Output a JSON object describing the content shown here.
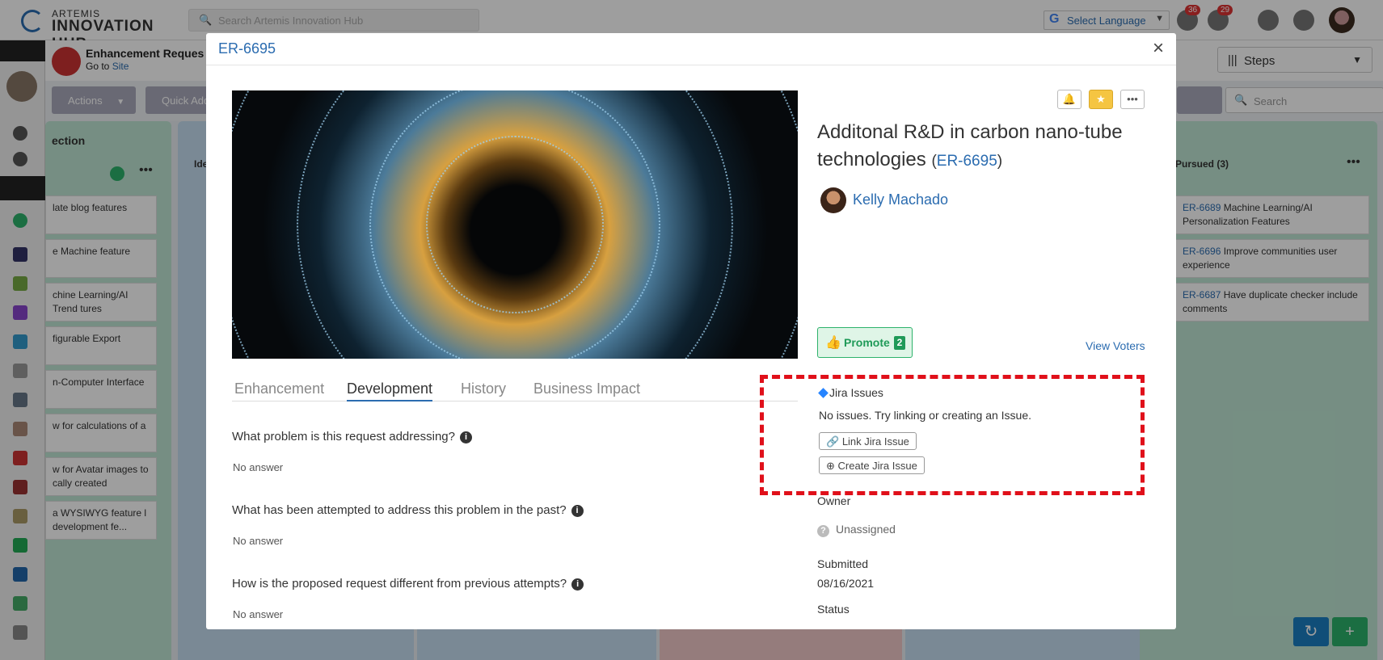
{
  "app": {
    "logo_top": "ARTEMIS",
    "logo_bottom": "INNOVATION HUB",
    "search_placeholder": "Search Artemis Innovation Hub",
    "language": "Select Language",
    "notifications_count": "36",
    "clock_count": "29"
  },
  "page": {
    "title": "Enhancement Reques",
    "subtitle_prefix": "Go to",
    "subtitle_link": "Site",
    "steps_label": "Steps",
    "actions_label": "Actions",
    "quick_add_label": "Quick Add",
    "search_placeholder": "Search"
  },
  "board": {
    "col1_title": "ection",
    "col2_title": "Ide",
    "col5_title": "Pursued (3)",
    "col1_cards": [
      "late blog features",
      "e Machine feature",
      "chine Learning/AI Trend tures",
      "figurable Export",
      "n-Computer Interface",
      "w for calculations of a",
      "w for Avatar images to cally created",
      "a WYSIWYG feature l development fe..."
    ],
    "pursued_cards": [
      {
        "id": "ER-6689",
        "text": "Machine Learning/AI Personalization Features"
      },
      {
        "id": "ER-6696",
        "text": "Improve communities user experience"
      },
      {
        "id": "ER-6687",
        "text": "Have duplicate checker include comments"
      }
    ]
  },
  "modal": {
    "id": "ER-6695",
    "close_glyph": "×",
    "title": "Additonal R&D in carbon nano-tube technologies",
    "title_paren_open": "(",
    "title_id": "ER-6695",
    "title_paren_close": ")",
    "author": "Kelly Machado",
    "promote_label": "Promote",
    "promote_count": "2",
    "view_voters": "View Voters",
    "tabs": [
      "Enhancement",
      "Development",
      "History",
      "Business Impact"
    ],
    "active_tab": "Development",
    "questions": [
      {
        "q": "What problem is this request addressing?",
        "a": "No answer"
      },
      {
        "q": "What has been attempted to address this problem in the past?",
        "a": "No answer"
      },
      {
        "q": "How is the proposed request different from previous attempts?",
        "a": "No answer"
      }
    ],
    "jira": {
      "title": "Jira Issues",
      "empty": "No issues. Try linking or creating an Issue.",
      "link_label": "Link Jira Issue",
      "create_label": "Create Jira Issue"
    },
    "owner_label": "Owner",
    "owner_value": "Unassigned",
    "submitted_label": "Submitted",
    "submitted_value": "08/16/2021",
    "status_label": "Status"
  },
  "colors": {
    "accent": "#2b6cb0",
    "promote_green": "#1f9a58",
    "highlight_red": "#e0101a",
    "star_yellow": "#f5c542"
  }
}
